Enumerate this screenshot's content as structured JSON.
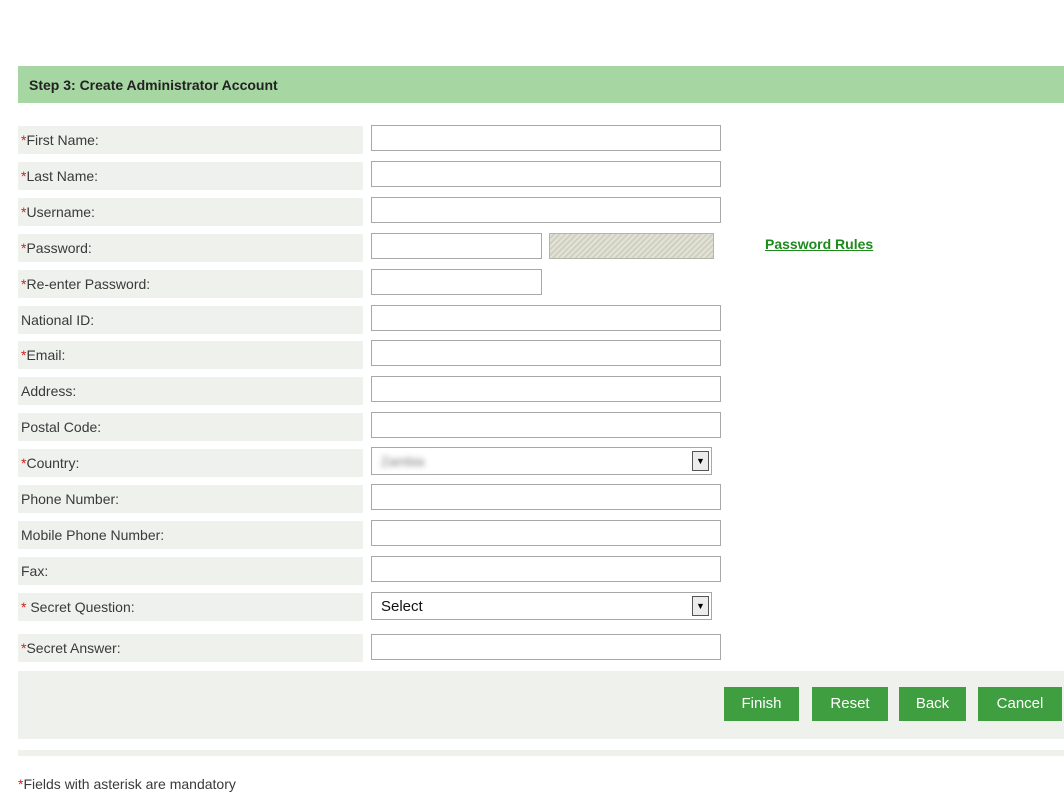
{
  "header": {
    "title": "Step 3: Create Administrator Account"
  },
  "fields": [
    {
      "required": true,
      "label": "First Name:"
    },
    {
      "required": true,
      "label": "Last Name:"
    },
    {
      "required": true,
      "label": "Username:"
    },
    {
      "required": true,
      "label": "Password:"
    },
    {
      "required": true,
      "label": "Re-enter Password:"
    },
    {
      "required": false,
      "label": "National ID:"
    },
    {
      "required": true,
      "label": "Email:"
    },
    {
      "required": false,
      "label": "Address:"
    },
    {
      "required": false,
      "label": "Postal Code:"
    },
    {
      "required": true,
      "label": "Country:",
      "value": "Zambia"
    },
    {
      "required": false,
      "label": "Phone Number:"
    },
    {
      "required": false,
      "label": "Mobile Phone Number:"
    },
    {
      "required": false,
      "label": "Fax:"
    },
    {
      "required": true,
      "label": " Secret Question:",
      "value": "Select"
    },
    {
      "required": true,
      "label": "Secret Answer:"
    }
  ],
  "password_rules_link": "Password Rules",
  "buttons": {
    "finish": "Finish",
    "reset": "Reset",
    "back": "Back",
    "cancel": "Cancel"
  },
  "footnote": {
    "asterisk": "*",
    "text": "Fields with asterisk are mandatory"
  },
  "colors": {
    "header_bg": "#a6d6a2",
    "button_bg": "#3f9e3f",
    "required_mark": "#d02020",
    "link": "#1c8a1c"
  }
}
